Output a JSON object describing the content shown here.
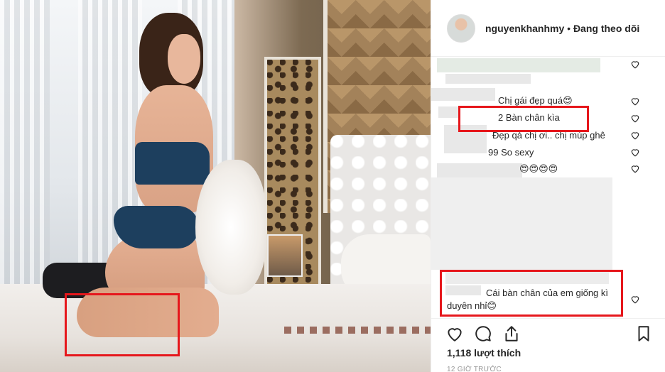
{
  "post": {
    "username": "nguyenkhanhmy",
    "separator": "•",
    "follow_status": "Đang theo dõi",
    "likes": "1,118 lượt thích",
    "time_ago": "12 GIỜ TRƯỚC"
  },
  "comments": [
    {
      "text": "Chị gái đẹp quá😍"
    },
    {
      "text": "2 Bàn chân kìa"
    },
    {
      "text": "Đẹp qá chị ơi.. chị múp ghê"
    },
    {
      "text": "99 So sexy"
    },
    {
      "text": "😍😍😍😍"
    },
    {
      "text": "Cái bàn chân của em giống kì"
    },
    {
      "text": "duyên nhỉ😊"
    }
  ],
  "colors": {
    "highlight": "#e6171c",
    "text": "#262626",
    "muted": "#999999",
    "border": "#efefef"
  },
  "icons": [
    "heart-icon",
    "comment-icon",
    "share-icon",
    "bookmark-icon"
  ]
}
